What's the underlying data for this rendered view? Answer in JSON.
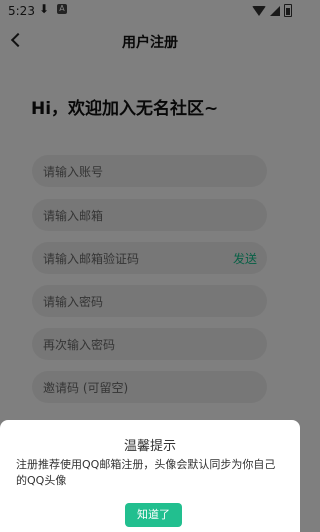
{
  "status_bar": {
    "time": "5:23",
    "icons": [
      "download-icon",
      "a-icon",
      "wifi-icon",
      "signal-icon",
      "battery-icon"
    ]
  },
  "header": {
    "title": "用户注册"
  },
  "page": {
    "greeting": "Hi，欢迎加入无名社区~"
  },
  "form": {
    "fields": [
      {
        "label": "请输入账号"
      },
      {
        "label": "请输入邮箱"
      },
      {
        "label": "请输入邮箱验证码",
        "action": "发送"
      },
      {
        "label": "请输入密码"
      },
      {
        "label": "再次输入密码"
      },
      {
        "label": "邀请码 (可留空)"
      }
    ]
  },
  "dialog": {
    "title": "温馨提示",
    "message": "注册推荐使用QQ邮箱注册，头像会默认同步为你自己的QQ头像",
    "button": "知道了"
  },
  "colors": {
    "accent": "#22bf8f",
    "link": "#12b886"
  }
}
